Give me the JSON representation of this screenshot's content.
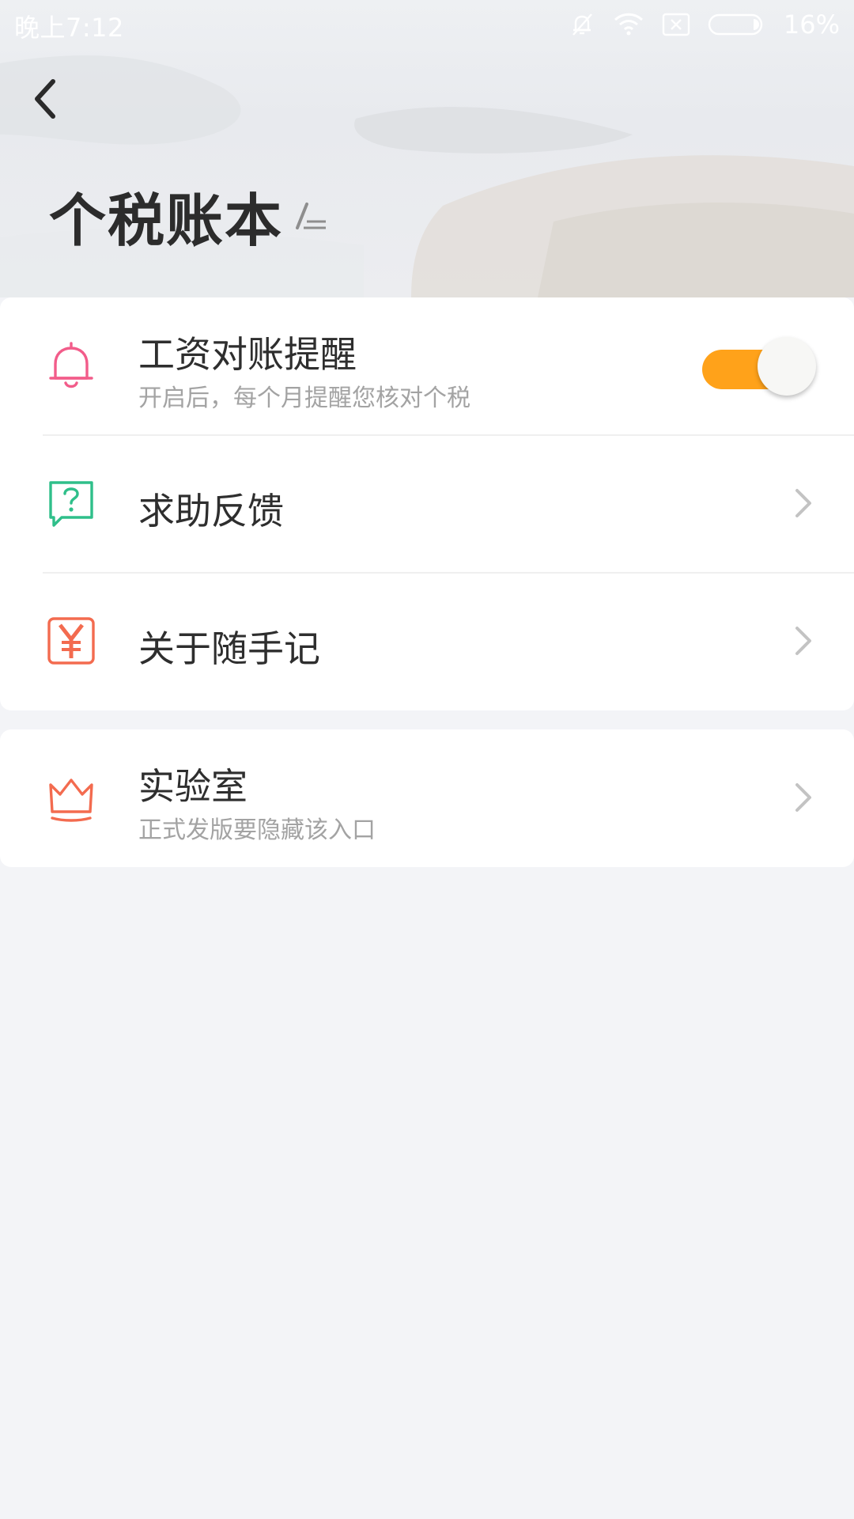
{
  "status_bar": {
    "time": "晚上7:12",
    "battery": "16%",
    "icons": [
      "bell-off-icon",
      "wifi-icon",
      "sim-x-icon",
      "battery-icon"
    ]
  },
  "header": {
    "title": "个税账本",
    "back_icon": "chevron-left-icon",
    "edit_icon": "edit-pen-icon"
  },
  "settings": {
    "items": [
      {
        "title": "工资对账提醒",
        "subtitle": "开启后，每个月提醒您核对个税",
        "icon": "bell-icon",
        "icon_color": "#f25c8a",
        "toggle_on": true,
        "toggle_color": "#ffa21a"
      },
      {
        "title": "求助反馈",
        "icon": "help-chat-icon",
        "icon_color": "#2fbf8a"
      },
      {
        "title": "关于随手记",
        "icon": "yuan-icon",
        "icon_color": "#f36b4f"
      }
    ],
    "lab": {
      "title": "实验室",
      "subtitle": "正式发版要隐藏该入口",
      "icon": "crown-icon",
      "icon_color": "#f36b4f"
    }
  }
}
